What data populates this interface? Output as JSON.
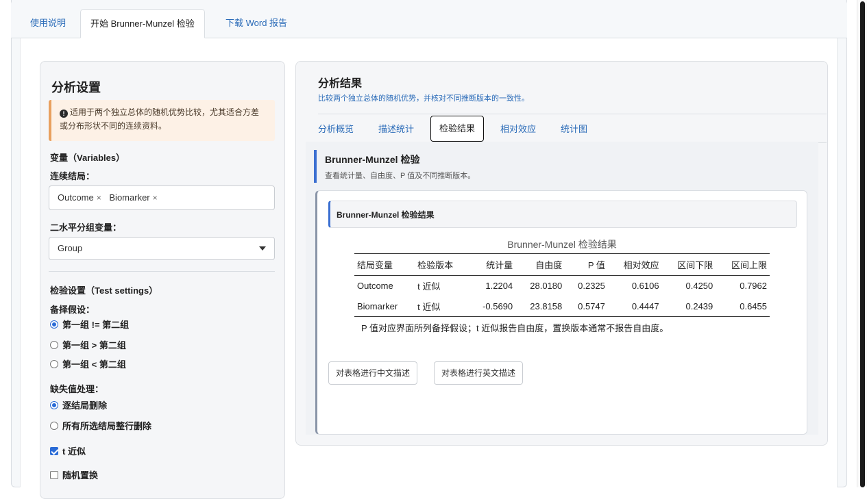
{
  "tabs": [
    {
      "label": "使用说明"
    },
    {
      "label": "开始 Brunner-Munzel 检验"
    },
    {
      "label": "下载 Word 报告"
    }
  ],
  "sidebar": {
    "title": "分析设置",
    "notice": "适用于两个独立总体的随机优势比较，尤其适合方差或分布形状不同的连续资料。",
    "variables_label": "变量（Variables）",
    "outcome_label": "连续结局：",
    "outcome_values": [
      "Outcome",
      "Biomarker"
    ],
    "group_label": "二水平分组变量：",
    "group_value": "Group",
    "test_settings_label": "检验设置（Test settings）",
    "alt_label": "备择假设：",
    "alt_options": [
      "第一组 != 第二组",
      "第一组 > 第二组",
      "第一组 < 第二组"
    ],
    "alt_selected": 0,
    "missing_label": "缺失值处理：",
    "missing_options": [
      "逐结局删除",
      "所有所选结局整行删除"
    ],
    "missing_selected": 0,
    "t_approx_label": "t 近似",
    "t_approx_checked": true,
    "perm_label": "随机置换",
    "perm_checked": false
  },
  "main": {
    "title": "分析结果",
    "subtitle": "比较两个独立总体的随机优势，并核对不同推断版本的一致性。",
    "subtabs": [
      "分析概览",
      "描述统计",
      "检验结果",
      "相对效应",
      "统计图"
    ],
    "active_subtab": 2,
    "section_title": "Brunner-Munzel 检验",
    "section_sub": "查看统计量、自由度、P 值及不同推断版本。",
    "card_title": "Brunner-Munzel 检验结果",
    "table": {
      "caption": "Brunner-Munzel 检验结果",
      "headers": [
        "结局变量",
        "检验版本",
        "统计量",
        "自由度",
        "P 值",
        "相对效应",
        "区间下限",
        "区间上限"
      ],
      "rows": [
        [
          "Outcome",
          "t 近似",
          "1.2204",
          "28.0180",
          "0.2325",
          "0.6106",
          "0.4250",
          "0.7962"
        ],
        [
          "Biomarker",
          "t 近似",
          "-0.5690",
          "23.8158",
          "0.5747",
          "0.4447",
          "0.2439",
          "0.6455"
        ]
      ],
      "note": "P 值对应界面所列备择假设；t 近似报告自由度，置换版本通常不报告自由度。"
    },
    "buttons": {
      "cn": "对表格进行中文描述",
      "en": "对表格进行英文描述"
    }
  }
}
